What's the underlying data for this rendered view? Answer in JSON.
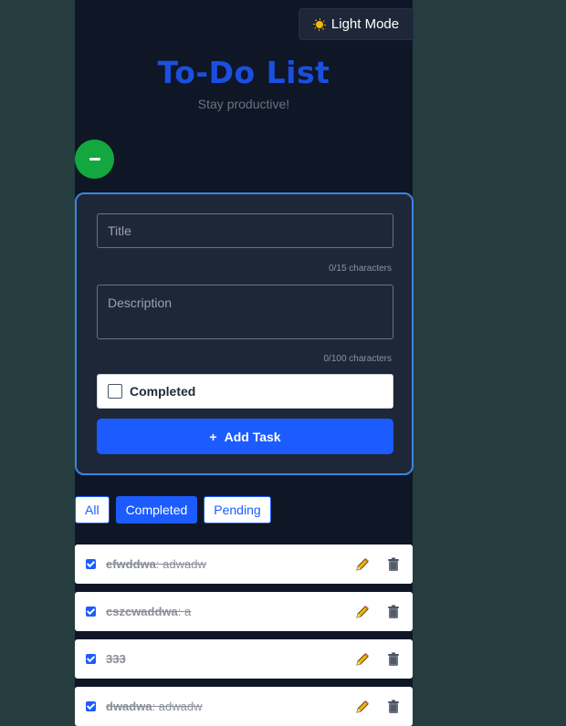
{
  "header": {
    "theme_toggle_label": "Light Mode",
    "title": "To-Do List",
    "subtitle": "Stay productive!"
  },
  "form": {
    "title_placeholder": "Title",
    "title_counter": "0/15 characters",
    "description_placeholder": "Description",
    "description_counter": "0/100 characters",
    "completed_label": "Completed",
    "add_button_label": "Add Task",
    "add_button_icon": "+"
  },
  "filters": {
    "all": "All",
    "completed": "Completed",
    "pending": "Pending",
    "active": "Completed"
  },
  "tasks": [
    {
      "title": "efwddwa",
      "description": ": adwadw",
      "completed": true
    },
    {
      "title": "cszcwaddwa",
      "description": ": a",
      "completed": true
    },
    {
      "title": "333",
      "description": "",
      "completed": true
    },
    {
      "title": "dwadwa",
      "description": ": adwadw",
      "completed": true
    }
  ],
  "colors": {
    "accent": "#1c5cff",
    "title": "#1b4fe0",
    "toggle_green": "#12a83f",
    "form_border": "#3a86e0",
    "app_bg": "#0f1626",
    "page_bg": "#263d3f"
  }
}
